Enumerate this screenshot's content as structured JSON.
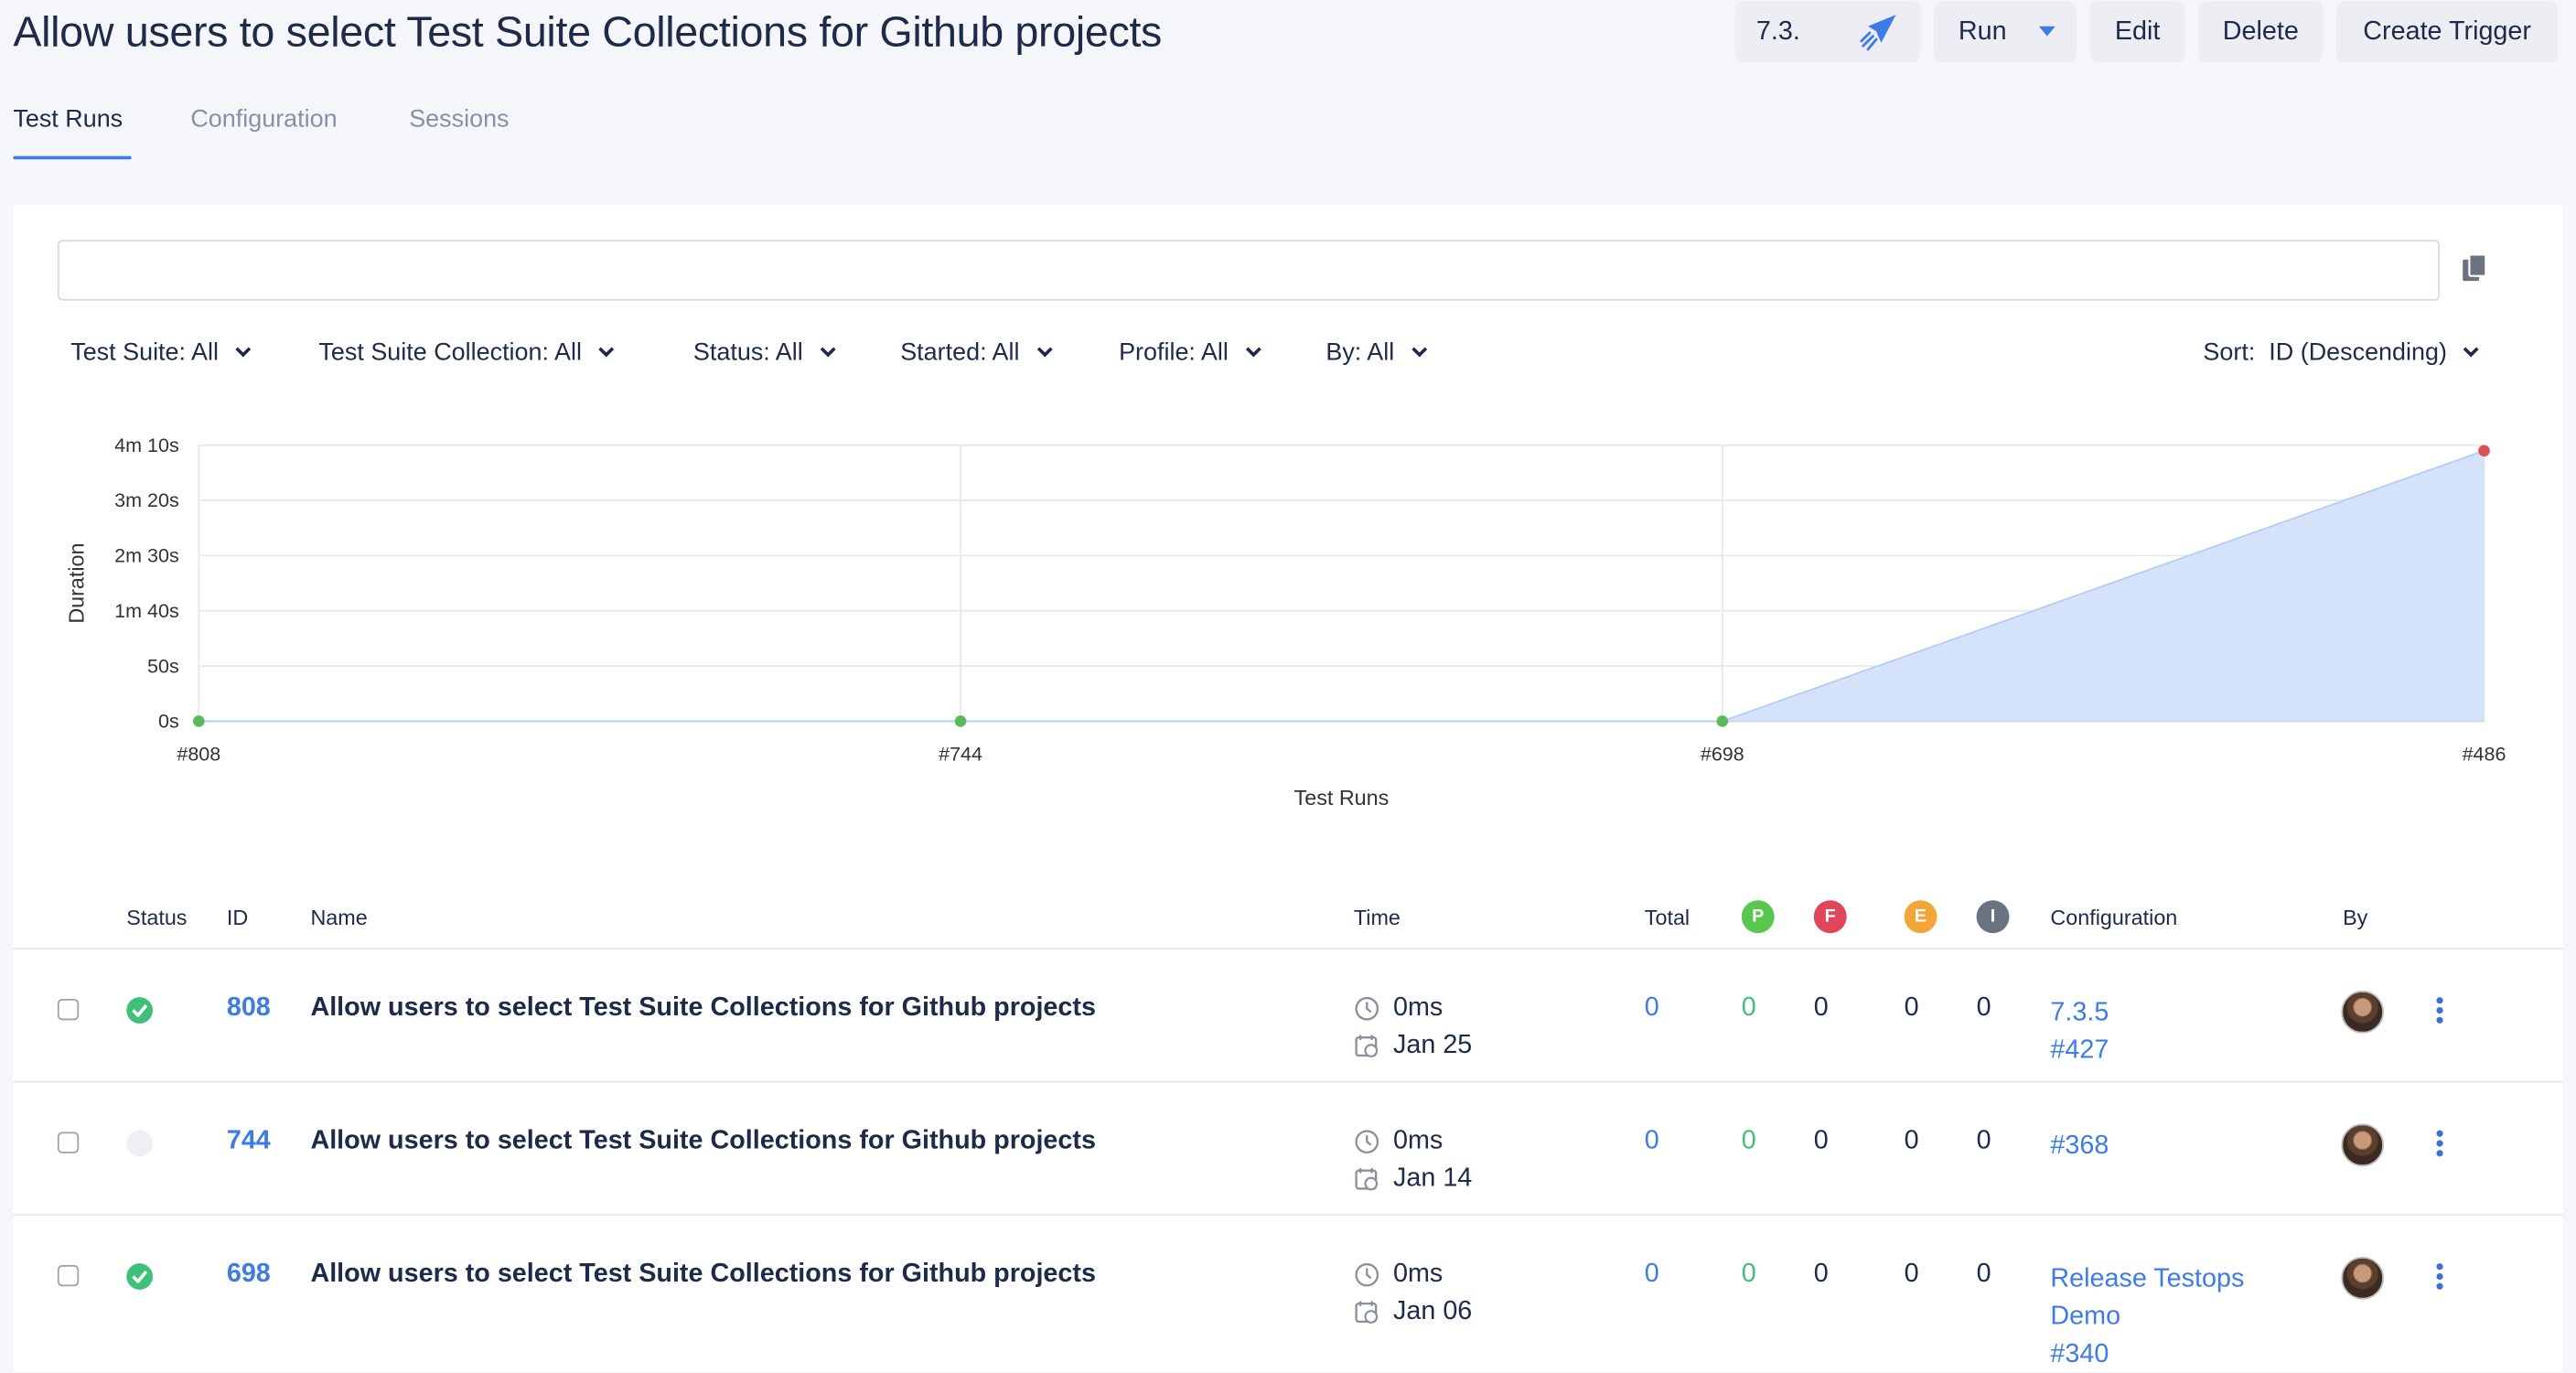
{
  "header": {
    "title": "Allow users to select Test Suite Collections for Github projects",
    "release_label": "7.3.",
    "run_label": "Run",
    "edit_label": "Edit",
    "delete_label": "Delete",
    "create_trigger_label": "Create Trigger"
  },
  "tabs": [
    {
      "label": "Test Runs",
      "active": true
    },
    {
      "label": "Configuration",
      "active": false
    },
    {
      "label": "Sessions",
      "active": false
    }
  ],
  "search": {
    "value": "",
    "placeholder": ""
  },
  "filters": {
    "test_suite": "Test Suite: All",
    "test_suite_collection": "Test Suite Collection: All",
    "status": "Status: All",
    "started": "Started: All",
    "profile": "Profile: All",
    "by": "By: All",
    "sort": "Sort:  ID (Descending)"
  },
  "chart_data": {
    "type": "area",
    "title": "",
    "xlabel": "Test Runs",
    "ylabel": "Duration",
    "categories": [
      "#808",
      "#744",
      "#698",
      "#486"
    ],
    "values": [
      0,
      0,
      0,
      245
    ],
    "value_unit": "seconds",
    "point_colors": [
      "#5cb85c",
      "#5cb85c",
      "#5cb85c",
      "#d9534f"
    ],
    "fill_color": "#cfe0fa",
    "yticks": [
      {
        "value": 0,
        "label": "0s"
      },
      {
        "value": 50,
        "label": "50s"
      },
      {
        "value": 100,
        "label": "1m 40s"
      },
      {
        "value": 150,
        "label": "2m 30s"
      },
      {
        "value": 200,
        "label": "3m 20s"
      },
      {
        "value": 250,
        "label": "4m 10s"
      }
    ],
    "ylim": [
      0,
      250
    ],
    "grid": true
  },
  "table": {
    "headers": {
      "status": "Status",
      "id": "ID",
      "name": "Name",
      "time": "Time",
      "total": "Total",
      "passed": "P",
      "failed": "F",
      "error": "E",
      "incomplete": "I",
      "configuration": "Configuration",
      "by": "By"
    },
    "badge_colors": {
      "passed": "#57c84d",
      "failed": "#e0465a",
      "error": "#f3a638",
      "incomplete": "#6b7280"
    },
    "rows": [
      {
        "status": "passed",
        "id": "808",
        "name": "Allow users to select Test Suite Collections for Github projects",
        "duration": "0ms",
        "date": "Jan 25",
        "total": "0",
        "passed": "0",
        "failed": "0",
        "error": "0",
        "incomplete": "0",
        "configuration": [
          "7.3.5",
          "#427"
        ]
      },
      {
        "status": "none",
        "id": "744",
        "name": "Allow users to select Test Suite Collections for Github projects",
        "duration": "0ms",
        "date": "Jan 14",
        "total": "0",
        "passed": "0",
        "failed": "0",
        "error": "0",
        "incomplete": "0",
        "configuration": [
          "#368"
        ]
      },
      {
        "status": "passed",
        "id": "698",
        "name": "Allow users to select Test Suite Collections for Github projects",
        "duration": "0ms",
        "date": "Jan 06",
        "total": "0",
        "passed": "0",
        "failed": "0",
        "error": "0",
        "incomplete": "0",
        "configuration": [
          "Release Testops",
          "Demo",
          "#340"
        ]
      }
    ]
  }
}
